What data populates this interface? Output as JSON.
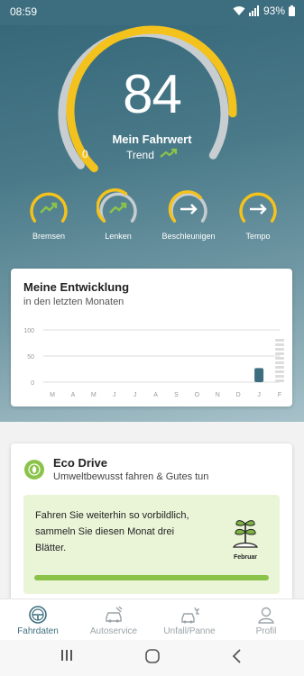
{
  "status": {
    "time": "08:59",
    "battery": "93%"
  },
  "score": {
    "value": "84",
    "label": "Mein Fahrwert",
    "min_label": "0",
    "trend_label": "Trend",
    "level": 0.84
  },
  "subscores": [
    {
      "label": "Bremsen",
      "icon": "trend-up-icon"
    },
    {
      "label": "Lenken",
      "icon": "trend-up-icon"
    },
    {
      "label": "Beschleunigen",
      "icon": "arrow-right-icon"
    },
    {
      "label": "Tempo",
      "icon": "arrow-right-icon"
    }
  ],
  "development": {
    "title": "Meine Entwicklung",
    "subtitle": "in den letzten Monaten"
  },
  "chart_data": {
    "type": "bar",
    "categories": [
      "M",
      "A",
      "M",
      "J",
      "J",
      "A",
      "S",
      "O",
      "N",
      "D",
      "J",
      "F"
    ],
    "values": [
      null,
      null,
      null,
      null,
      null,
      null,
      null,
      null,
      null,
      null,
      27,
      null
    ],
    "projected": [
      null,
      null,
      null,
      null,
      null,
      null,
      null,
      null,
      null,
      null,
      null,
      84
    ],
    "ylim": [
      0,
      100
    ],
    "yticks": [
      "100",
      "50",
      "0"
    ],
    "grid": true
  },
  "eco": {
    "title": "Eco Drive",
    "subtitle": "Umweltbewusst fahren & Gutes tun",
    "message": "Fahren Sie weiterhin so vorbildlich, sammeln Sie diesen Monat drei Blätter.",
    "month": "Februar",
    "progress": 1.0
  },
  "nav": [
    {
      "label": "Fahrdaten",
      "icon": "steering-wheel-icon",
      "active": true
    },
    {
      "label": "Autoservice",
      "icon": "car-service-icon",
      "active": false
    },
    {
      "label": "Unfall/Panne",
      "icon": "car-crash-icon",
      "active": false
    },
    {
      "label": "Profil",
      "icon": "profile-icon",
      "active": false
    }
  ],
  "colors": {
    "accent": "#f4c21c",
    "track": "#c7cdd0",
    "brand": "#3d6e7f",
    "green": "#8bc34a"
  }
}
